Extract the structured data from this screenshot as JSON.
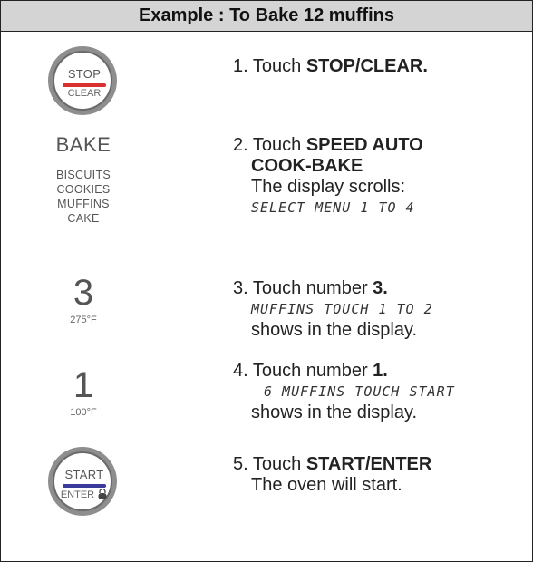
{
  "header": {
    "title": "Example : To Bake 12 muffins"
  },
  "stop_button": {
    "top": "STOP",
    "bottom": "CLEAR",
    "bar_color": "#d93030"
  },
  "start_button": {
    "top": "START",
    "bottom": "ENTER",
    "bar_color": "#3a3a9a"
  },
  "bake": {
    "label": "BAKE",
    "items": [
      "BISCUITS",
      "COOKIES",
      "MUFFINS",
      "CAKE"
    ]
  },
  "num3": {
    "digit": "3",
    "temp": "275°F"
  },
  "num1": {
    "digit": "1",
    "temp": "100°F"
  },
  "steps": {
    "s1": {
      "prefix": "1. Touch ",
      "bold": "STOP/CLEAR."
    },
    "s2": {
      "prefix": "2. Touch  ",
      "bold1": "SPEED AUTO",
      "bold2": "COOK-BAKE",
      "line": "The display scrolls:",
      "lcd": "SELECT MENU 1 TO 4"
    },
    "s3": {
      "prefix": "3. Touch number ",
      "bold": "3.",
      "lcd": "MUFFINS TOUCH 1 TO 2",
      "line": "shows in the display."
    },
    "s4": {
      "prefix": "4. Touch number ",
      "bold": "1.",
      "lcd": "6 MUFFINS TOUCH START",
      "line": "shows in the display."
    },
    "s5": {
      "prefix": "5. Touch ",
      "bold": "START/ENTER",
      "line": "The oven will start."
    }
  }
}
